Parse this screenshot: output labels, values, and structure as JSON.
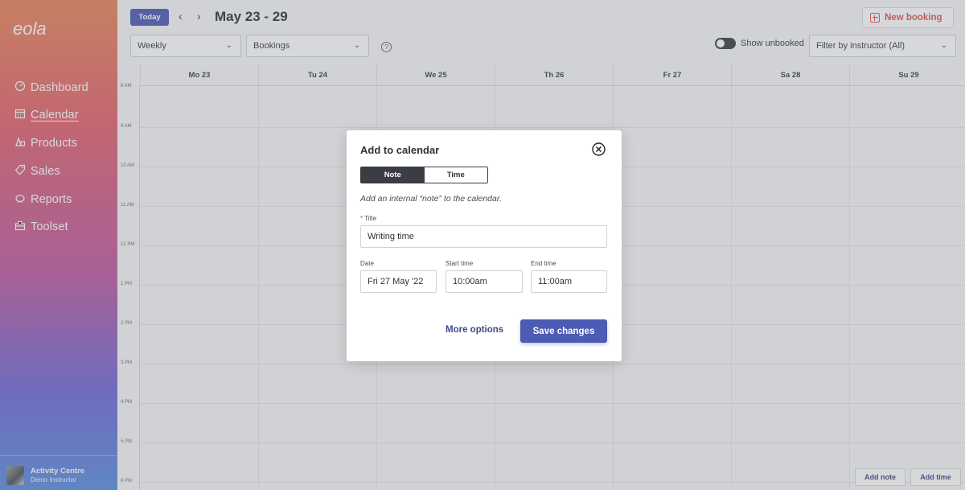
{
  "sidebar": {
    "logo": "eola",
    "items": [
      {
        "label": "Dashboard",
        "icon": "dashboard-icon",
        "active": false
      },
      {
        "label": "Calendar",
        "icon": "calendar-icon",
        "active": true
      },
      {
        "label": "Products",
        "icon": "products-icon",
        "active": false
      },
      {
        "label": "Sales",
        "icon": "tag-icon",
        "active": false
      },
      {
        "label": "Reports",
        "icon": "piggy-bank-icon",
        "active": false
      },
      {
        "label": "Toolset",
        "icon": "toolset-icon",
        "active": false
      }
    ],
    "profile": {
      "name": "Activity Centre",
      "role": "Demo Instructor"
    }
  },
  "toolbar": {
    "today_label": "Today",
    "prev_icon": "chevron-left-icon",
    "next_icon": "chevron-right-icon",
    "date_range": "May 23 - 29",
    "new_booking_label": "New booking",
    "view_select": "Weekly",
    "type_select": "Bookings",
    "show_unbooked_label": "Show unbooked",
    "instructor_filter": "Filter by instructor (All)"
  },
  "calendar": {
    "days": [
      "Mo 23",
      "Tu 24",
      "We 25",
      "Th 26",
      "Fr 27",
      "Sa 28",
      "Su 29"
    ],
    "times": [
      "8 AM",
      "9 AM",
      "10 AM",
      "11 AM",
      "12 PM",
      "1 PM",
      "2 PM",
      "3 PM",
      "4 PM",
      "5 PM",
      "6 PM"
    ]
  },
  "footer": {
    "add_note_label": "Add note",
    "add_time_label": "Add time"
  },
  "modal": {
    "title": "Add to calendar",
    "tabs": {
      "note": "Note",
      "time": "Time",
      "selected": "Note"
    },
    "hint": "Add an internal “note” to the calendar.",
    "title_label": "Title",
    "title_value": "Writing time",
    "date_label": "Date",
    "date_value": "Fri 27 May '22",
    "start_label": "Start time",
    "start_value": "10:00am",
    "end_label": "End time",
    "end_value": "11:00am",
    "more_options_label": "More options",
    "save_label": "Save changes"
  },
  "colors": {
    "accent": "#4c5bb3",
    "danger": "#e05656"
  }
}
